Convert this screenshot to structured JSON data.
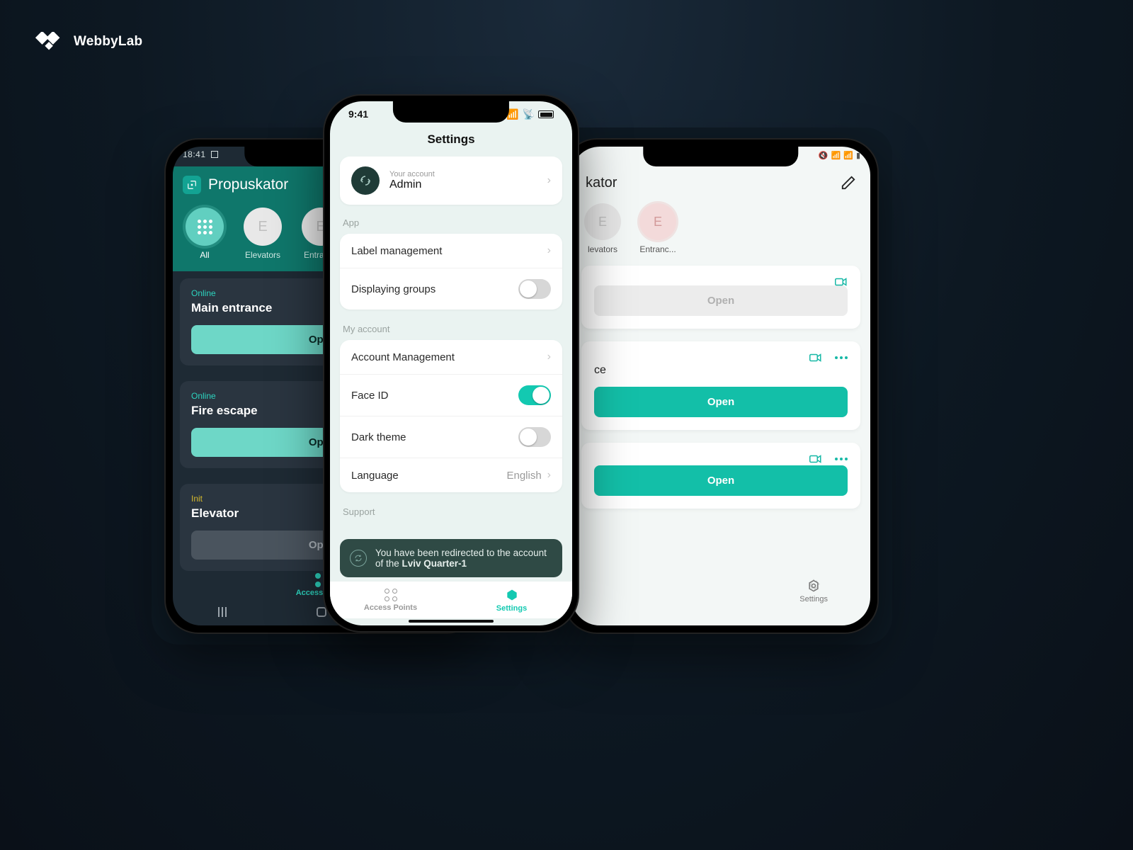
{
  "brand": "WebbyLab",
  "left": {
    "status_time": "18:41",
    "app_name": "Propuskator",
    "groups": [
      {
        "label": "All"
      },
      {
        "letter": "E",
        "label": "Elevators"
      },
      {
        "letter": "E",
        "label": "Entranc.."
      }
    ],
    "cards": [
      {
        "status_text": "Online",
        "status": "online",
        "name": "Main entrance",
        "btn": "Open",
        "disabled": false
      },
      {
        "status_text": "Online",
        "status": "online",
        "name": "Fire escape",
        "btn": "Open",
        "disabled": false
      },
      {
        "status_text": "Init",
        "status": "init",
        "name": "Elevator",
        "btn": "Open",
        "disabled": true
      }
    ],
    "nav_label": "Access points"
  },
  "right": {
    "title_suffix": "kator",
    "groups": [
      {
        "letter": "E",
        "label": "levators"
      },
      {
        "letter": "E",
        "label": "Entranc..."
      }
    ],
    "cards": [
      {
        "name": "",
        "btn": "Open",
        "disabled": true,
        "more": false
      },
      {
        "name": "ce",
        "btn": "Open",
        "disabled": false,
        "more": true
      },
      {
        "name": "",
        "btn": "Open",
        "disabled": false,
        "more": true
      }
    ],
    "nav_label": "Settings"
  },
  "center": {
    "status_time": "9:41",
    "title": "Settings",
    "account": {
      "caption": "Your account",
      "name": "Admin"
    },
    "sections": {
      "app": {
        "label": "App",
        "label_mgmt": "Label management",
        "display_groups": "Displaying groups"
      },
      "account": {
        "label": "My account",
        "acct_mgmt": "Account Management",
        "face_id": "Face ID",
        "dark_theme": "Dark theme",
        "language_label": "Language",
        "language_value": "English"
      },
      "support": {
        "label": "Support"
      }
    },
    "toast": {
      "line": "You have been redirected to the account of the ",
      "bold": "Lviv Quarter-1"
    },
    "nav": {
      "ap": "Access Points",
      "settings": "Settings"
    }
  }
}
